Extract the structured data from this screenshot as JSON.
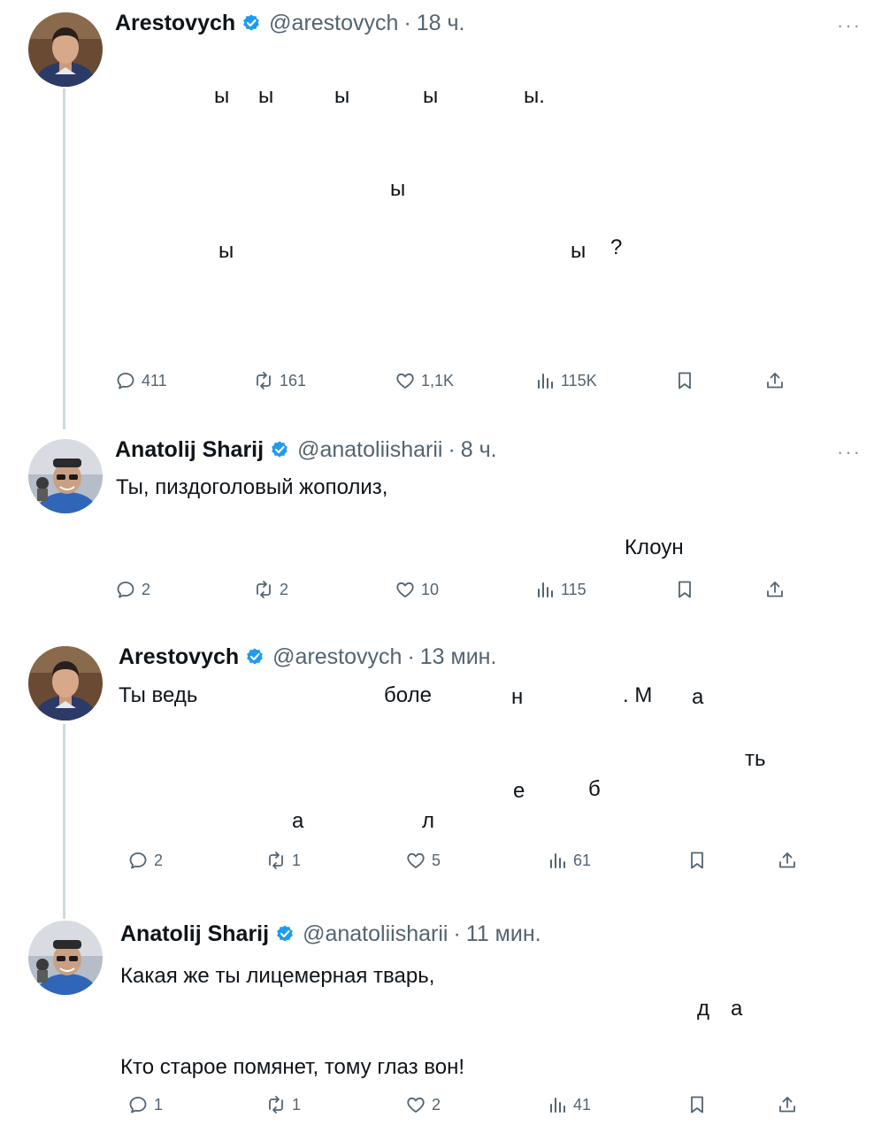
{
  "tweets": [
    {
      "name": "Arestovych",
      "handle": "@arestovych",
      "time": "18 ч.",
      "more": "···",
      "fragments": [
        "ы",
        "ы",
        "ы",
        "ы",
        "ы.",
        "ы",
        "ы",
        "ы",
        "?"
      ],
      "replies": "411",
      "reposts": "161",
      "likes": "1,1K",
      "views": "115K"
    },
    {
      "name": "Anatolij Sharij",
      "handle": "@anatoliisharii",
      "time": "8 ч.",
      "more": "···",
      "line1": "Ты, пиздоголовый жополиз,",
      "line2": "Клоун",
      "replies": "2",
      "reposts": "2",
      "likes": "10",
      "views": "115"
    },
    {
      "name": "Arestovych",
      "handle": "@arestovych",
      "time": "13 мин.",
      "fragments": [
        "Ты ведь",
        "боле",
        "н",
        ". М",
        "а",
        "ть",
        "е",
        "б",
        "а",
        "л"
      ],
      "replies": "2",
      "reposts": "1",
      "likes": "5",
      "views": "61"
    },
    {
      "name": "Anatolij Sharij",
      "handle": "@anatoliisharii",
      "time": "11 мин.",
      "line1": "Какая же ты лицемерная тварь,",
      "fragments": [
        "д",
        "а"
      ],
      "line3": "Кто старое помянет, тому глаз вон!",
      "replies": "1",
      "reposts": "1",
      "likes": "2",
      "views": "41"
    }
  ],
  "colors": {
    "verified": "#1d9bf0",
    "secondary_text": "#536471",
    "thread_line": "#cfd9de"
  },
  "icons": [
    "reply-icon",
    "repost-icon",
    "like-icon",
    "views-icon",
    "bookmark-icon",
    "share-icon",
    "verified-badge-icon",
    "more-icon"
  ]
}
